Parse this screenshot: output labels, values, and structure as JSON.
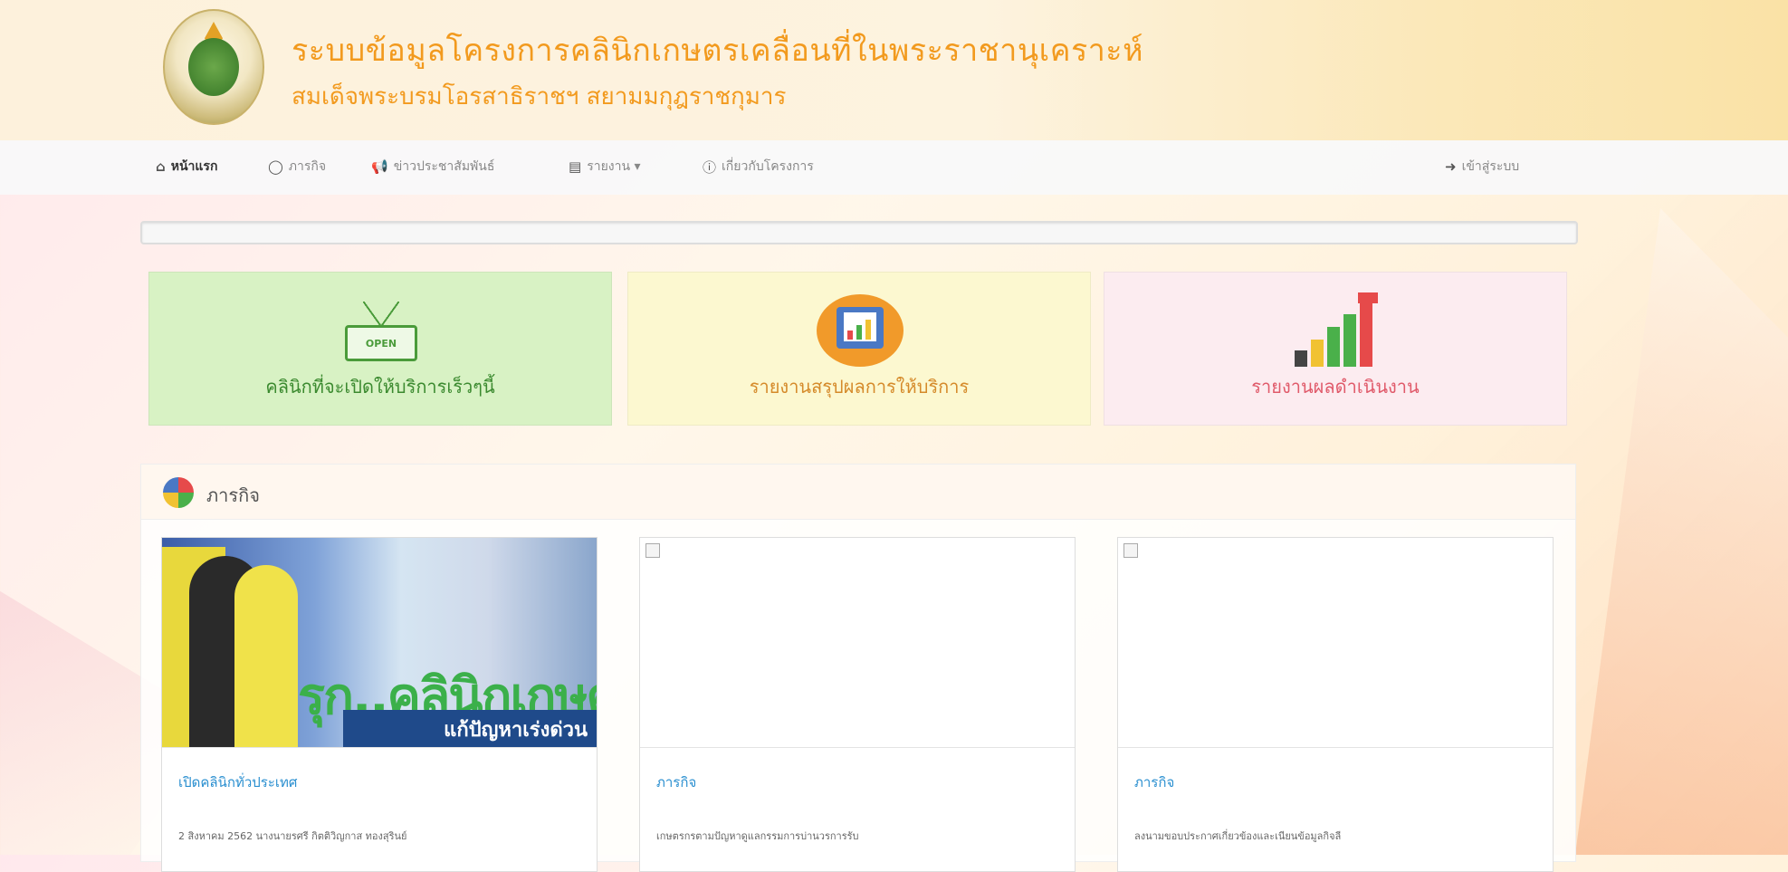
{
  "header": {
    "title": "ระบบข้อมูลโครงการคลินิกเกษตรเคลื่อนที่ในพระราชานุเคราะห์",
    "subtitle": "สมเด็จพระบรมโอรสาธิราชฯ สยามมกุฎราชกุมาร"
  },
  "nav": {
    "items": [
      {
        "label": "หน้าแรก",
        "icon": "home-icon"
      },
      {
        "label": "ภารกิจ",
        "icon": "globe-icon"
      },
      {
        "label": "ข่าวประชาสัมพันธ์",
        "icon": "bullhorn-icon"
      },
      {
        "label": "รายงาน ▾",
        "icon": "chart-icon"
      },
      {
        "label": "เกี่ยวกับโครงการ",
        "icon": "info-icon"
      }
    ],
    "login": "เข้าสู่ระบบ"
  },
  "progress": {
    "value": 0
  },
  "tiles": [
    {
      "label": "คลินิกที่จะเปิดให้บริการเร็วๆนี้",
      "sign": "OPEN",
      "color": "#d8f2c4"
    },
    {
      "label": "รายงานสรุปผลการให้บริการ",
      "color": "#fcf8d0"
    },
    {
      "label": "รายงานผลดำเนินงาน",
      "color": "#fcecf0"
    }
  ],
  "mission": {
    "title": "ภารกิจ",
    "cards": [
      {
        "title": "เปิดคลินิกทั่วประเทศ",
        "date": "2 สิงหาคม 2562 นางนายรศรี กิตติวิญกาส ทองสุรินย์",
        "banner_big": "รุก..คลินิกเกษตร",
        "banner_strip": "แก้ปัญหาเร่งด่วน"
      },
      {
        "title": "ภารกิจ",
        "date": "เกษตรกรตามปัญหาดูแลกรรมการบ่านวรการรับ"
      },
      {
        "title": "ภารกิจ",
        "date": "ลงนามขอบประกาศเกี่ยวข้องและเนียนข้อมูลกิจลี"
      }
    ]
  }
}
